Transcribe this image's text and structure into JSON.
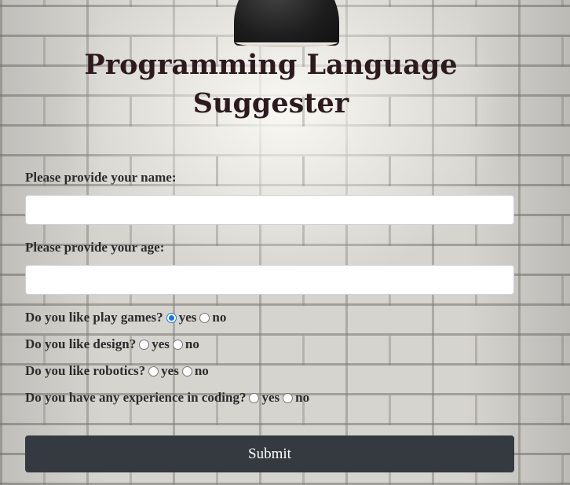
{
  "page": {
    "title": "Programming Language Suggester"
  },
  "form": {
    "name_label": "Please provide your name:",
    "name_value": "",
    "age_label": "Please provide your age:",
    "age_value": "",
    "questions": [
      {
        "text": "Do you like play games?",
        "yes": "yes",
        "no": "no",
        "selected": "yes"
      },
      {
        "text": "Do you like design?",
        "yes": "yes",
        "no": "no",
        "selected": null
      },
      {
        "text": "Do you like robotics?",
        "yes": "yes",
        "no": "no",
        "selected": null
      },
      {
        "text": "Do you have any experience in coding?",
        "yes": "yes",
        "no": "no",
        "selected": null
      }
    ],
    "submit_label": "Submit"
  },
  "colors": {
    "title": "#2d1a1f",
    "button_bg": "#343a40",
    "radio_checked": "#1a73e8"
  },
  "icons": {
    "lamp": "pendant-lamp-icon"
  }
}
